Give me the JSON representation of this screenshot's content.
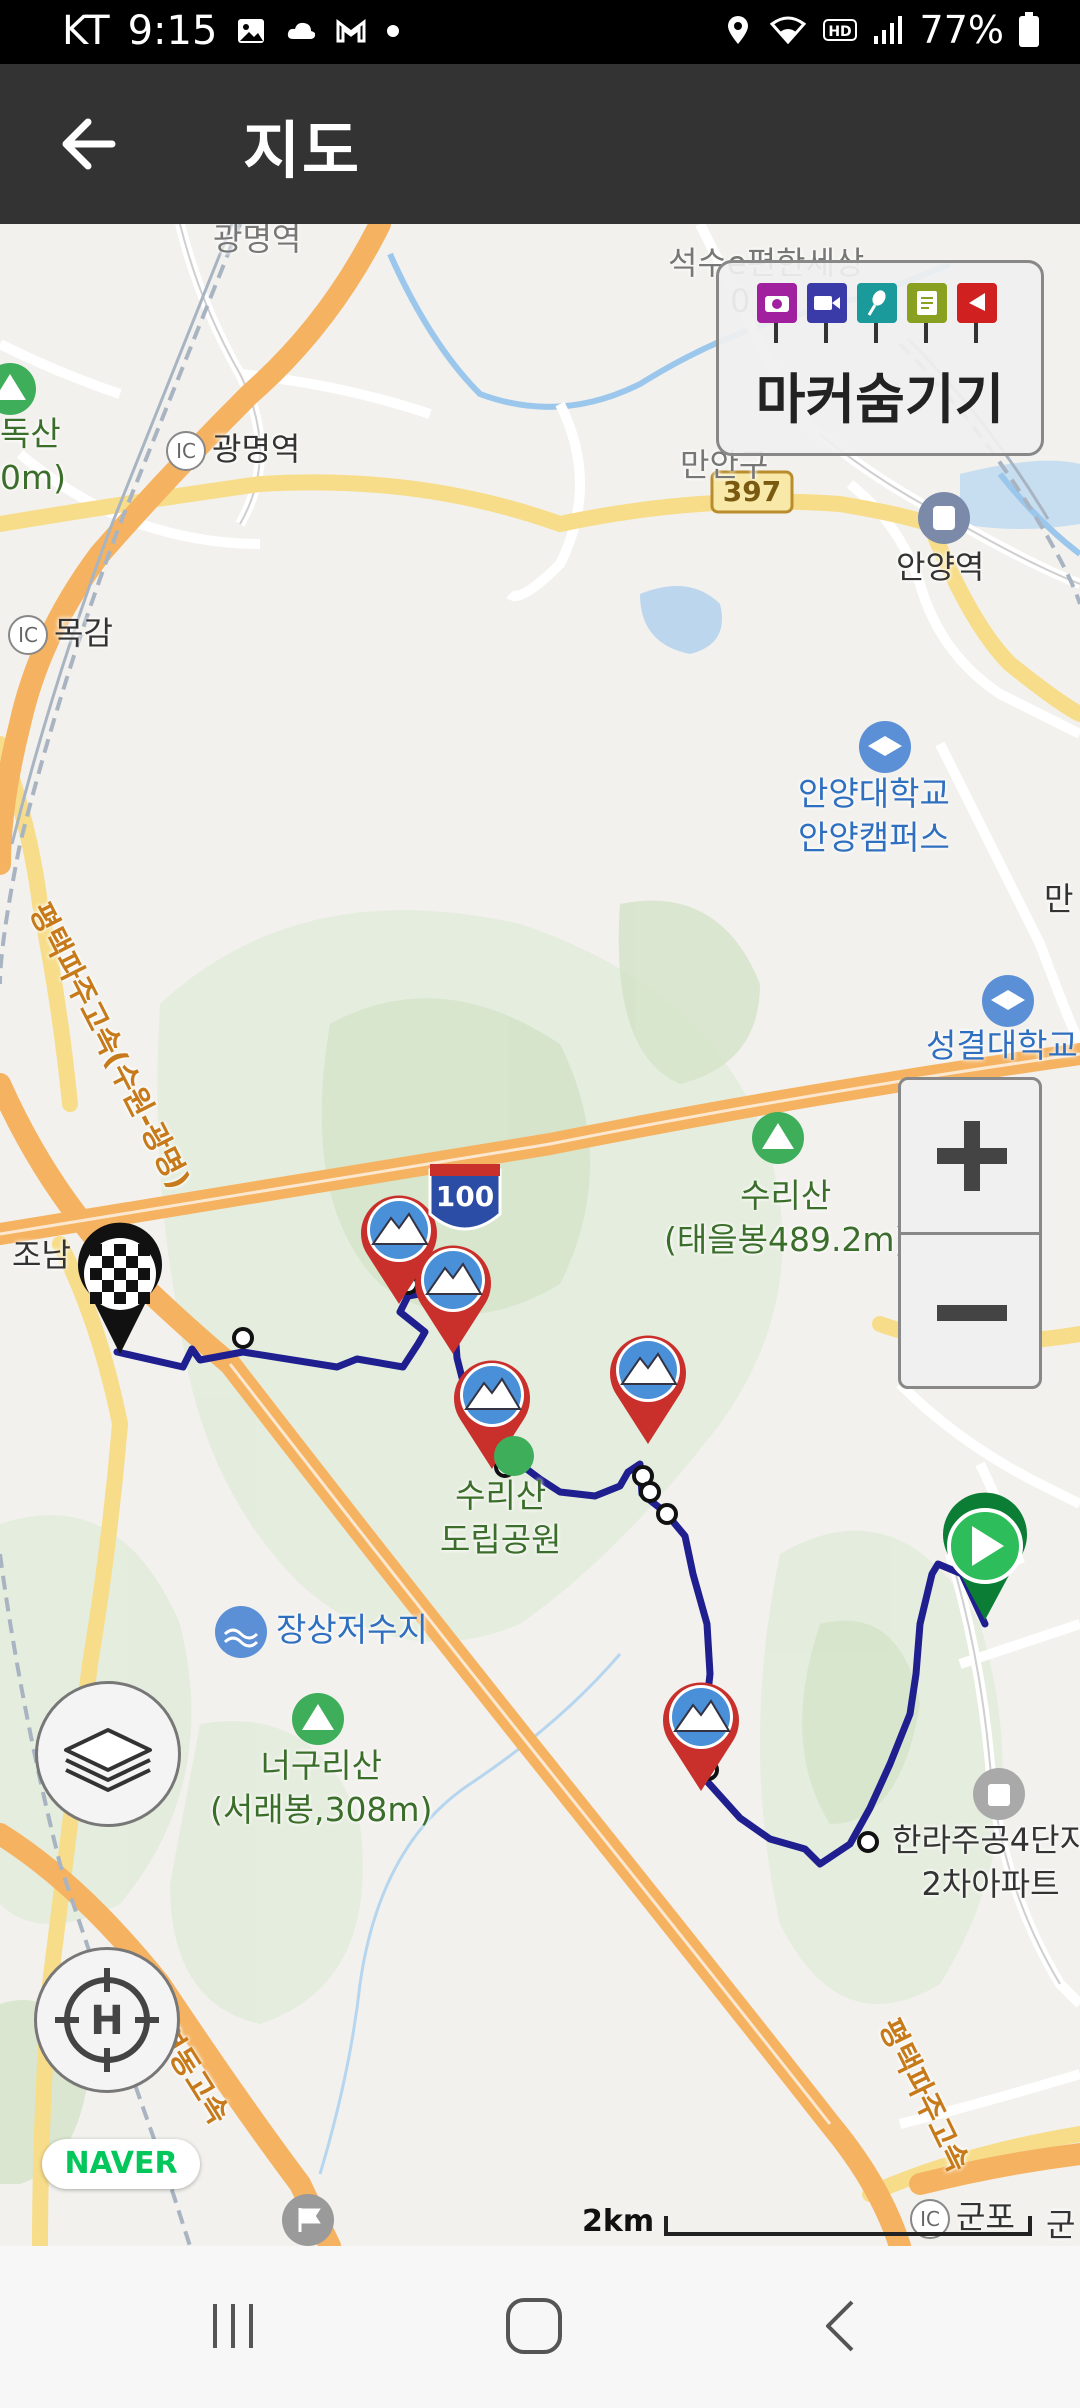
{
  "status_bar": {
    "carrier": "KT",
    "time": "9:15",
    "battery": "77%",
    "icons": [
      "image-icon",
      "cloud-icon",
      "gmail-icon",
      "dot-icon",
      "location-icon",
      "wifi-icon",
      "hd-icon",
      "signal-icon",
      "battery-icon"
    ]
  },
  "app_bar": {
    "title": "지도",
    "back_icon": "arrow-left-icon"
  },
  "marker_panel": {
    "label": "마커숨기기",
    "pin_colors": [
      "#a020a0",
      "#3a3aa8",
      "#1a9a9a",
      "#8aa020",
      "#d02020"
    ]
  },
  "zoom": {
    "in_icon": "plus-icon",
    "out_icon": "minus-icon"
  },
  "map": {
    "places": {
      "gwangmyeong_station_top": "광명역",
      "seoksu": "석수e편한세상",
      "seoksu_sub": "0",
      "dok_mountain": "독산",
      "dok_mountain_sub": "0m)",
      "gwangmyeong_ic": "광명역",
      "manan": "만안구",
      "route_397": "397",
      "anyang_station": "안양역",
      "mokgam": "목감",
      "anyang_univ_1": "안양대학교",
      "anyang_univ_2": "안양캠퍼스",
      "man_edge": "만",
      "sungkyul": "성결대학교",
      "expressway_1": "평택파주고속(수원-광명)",
      "route_100": "100",
      "surisan_1": "수리산",
      "surisan_2": "(태을봉489.2m)",
      "jonam": "조남",
      "surisan_park_1": "수리산",
      "surisan_park_2": "도립공원",
      "jangsang": "장상저수지",
      "neoguri_1": "너구리산",
      "neoguri_2": "(서래봉,308m)",
      "hanra_1": "한라주공4단지",
      "hanra_2": "2차아파트",
      "yeongdong": "영동고속",
      "expressway_2": "평택파주고속",
      "gunpo_ic": "군포",
      "gunpo_edge": "군"
    },
    "ic_label": "IC",
    "provider": "NAVER",
    "scale": "2km"
  },
  "round_buttons": {
    "layers_icon": "layers-icon",
    "home_icon": "home-target-icon"
  },
  "nav_bar": {
    "icons": [
      "recent-apps-icon",
      "home-icon",
      "back-icon"
    ]
  }
}
